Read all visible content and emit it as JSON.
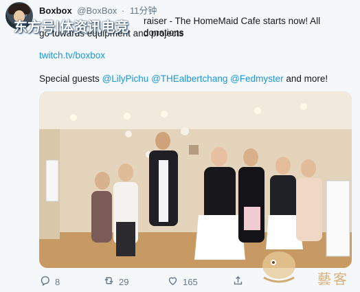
{
  "tweet": {
    "display_name": "Boxbox",
    "handle": "@BoxBox",
    "separator": "·",
    "time": "11分钟",
    "overlay_watermark": "东方号|体资讯电竞",
    "text_line1": "raiser - The HomeMaid Cafe starts now! All donations",
    "text_line2": "go towards equipment and projects",
    "link": "twitch.tv/boxbox",
    "guests_prefix": "Special guests",
    "mentions": [
      "@LilyPichu",
      "@THEalbertchang",
      "@Fedmyster"
    ],
    "guests_suffix": "and more!"
  },
  "actions": {
    "reply_count": "8",
    "retweet_count": "29",
    "like_count": "165"
  },
  "icons": [
    "reply-icon",
    "retweet-icon",
    "like-icon",
    "share-icon"
  ],
  "colors": {
    "link": "#1b95e0",
    "muted": "#657786",
    "background": "#f5f8fa"
  },
  "bottom_watermark": "藝客"
}
